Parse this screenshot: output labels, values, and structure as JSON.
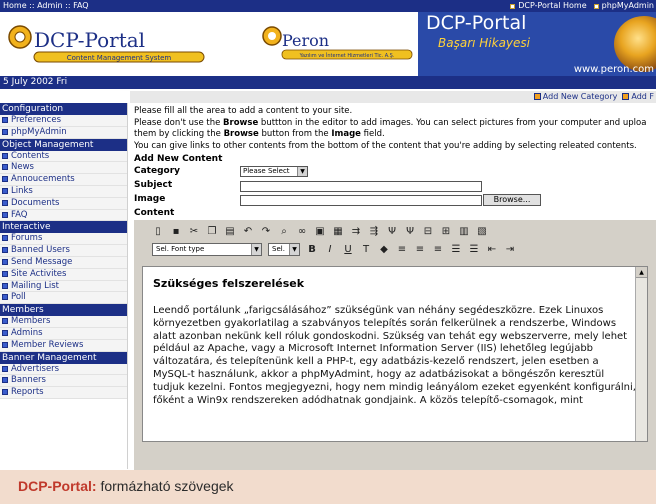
{
  "topbar": {
    "breadcrumb": "Home :: Admin :: FAQ",
    "links": [
      "DCP-Portal Home",
      "phpMyAdmin"
    ]
  },
  "banner": {
    "logo1_text": "DCP-Portal",
    "logo1_sub": "Content Management System",
    "logo2_text": "Peron",
    "logo2_sub": "Yazılım ve İnternet Hizmetleri Tic. A.Ş.",
    "blue_title": "DCP-Portal",
    "blue_sub": "Başarı Hikayesi",
    "blue_url": "www.peron.com"
  },
  "datebar": {
    "date": "5 July 2002 Fri"
  },
  "actionbar": {
    "actions": [
      "Add New Category",
      "Add F"
    ]
  },
  "sidebar": {
    "sections": [
      {
        "title": "Configuration",
        "items": [
          "Preferences",
          "phpMyAdmin"
        ]
      },
      {
        "title": "Object Management",
        "items": [
          "Contents",
          "News",
          "Annoucements",
          "Links",
          "Documents",
          "FAQ"
        ]
      },
      {
        "title": "Interactive",
        "items": [
          "Forums",
          "Banned Users",
          "Send Message",
          "Site Activites",
          "Mailing List",
          "Poll"
        ]
      },
      {
        "title": "Members",
        "items": [
          "Members",
          "Admins",
          "Member Reviews"
        ]
      },
      {
        "title": "Banner Management",
        "items": [
          "Advertisers",
          "Banners",
          "Reports"
        ]
      }
    ]
  },
  "content": {
    "info1": "Please fill all the area to add a content to your site.",
    "info2_pre": "Please don't use the ",
    "info2_bold": "Browse",
    "info2_post": " buttton in the editor to add images. You can select pictures from your computer and uploa",
    "info3_pre": "them by clicking the ",
    "info3_bold1": "Browse",
    "info3_mid": " button from the ",
    "info3_bold2": "Image",
    "info3_post": " field.",
    "info4": "You can give links to other contents from the bottom of the content that you're adding by selecting releated contents.",
    "form_title": "Add New Content",
    "label_category": "Category",
    "category_value": "Please Select",
    "label_subject": "Subject",
    "label_image": "Image",
    "browse_label": "Browse...",
    "label_content": "Content"
  },
  "editor": {
    "font_select": "Sel. Font type",
    "size_select": "Sel.",
    "heading": "Szükséges felszerelések",
    "body": "Leendő portálunk „farigcsálásához” szükségünk van néhány segédeszközre. Ezek Linuxos környezetben gyakorlatilag a szabványos telepítés során felkerülnek a rendszerbe, Windows alatt azonban nekünk kell róluk gondoskodni. Szükség van tehát egy webszerverre, mely lehet például az Apache, vagy a Microsoft Internet Information Server (IIS) lehetőleg legújabb változatára, és telepítenünk kell a PHP-t, egy adatbázis-kezelő rendszert, jelen esetben a MySQL-t használunk, akkor a phpMyAdmint, hogy az adatbázisokat a böngészőn keresztül tudjuk kezelni. Fontos megjegyezni, hogy nem mindig leányálom ezeket egyenként konfigurálni, főként a Win9x rendszereken adódhatnak gondjaink. A közös telepítő-csomagok, mint"
  },
  "caption": {
    "part1": "DCP-Portal:",
    "part2": " formázható szövegek"
  },
  "colors": {
    "navy": "#1c2f86",
    "caption_bg": "#f2dccd",
    "caption_accent": "#c0392b"
  }
}
